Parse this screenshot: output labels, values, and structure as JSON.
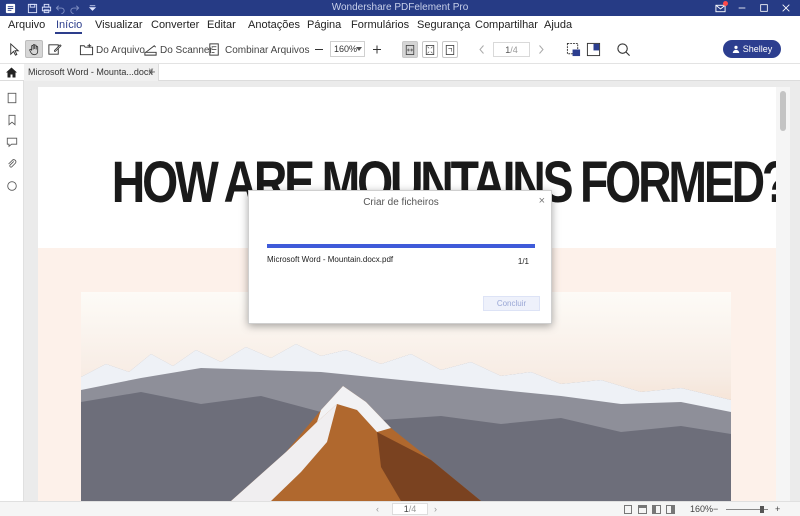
{
  "app": {
    "title": "Wondershare PDFelement Pro"
  },
  "menu": {
    "items": [
      "Arquivo",
      "Início",
      "Visualizar",
      "Converter",
      "Editar",
      "Anotações",
      "Página",
      "Formulários",
      "Segurança",
      "Compartilhar",
      "Ajuda"
    ],
    "active": "Início"
  },
  "toolbar": {
    "from_file": "Do Arquivo",
    "from_scanner": "Do Scanner",
    "combine": "Combinar Arquivos",
    "zoom": "160%",
    "page_current": "1",
    "page_total": "/4",
    "user": "Shelley"
  },
  "tabs": {
    "doc_tab": "Microsoft Word - Mounta...docx"
  },
  "document": {
    "headline": "HOW ARE MOUNTAINS FORMED?"
  },
  "modal": {
    "title": "Criar de ficheiros",
    "filename": "Microsoft Word - Mountain.docx.pdf",
    "count": "1/1",
    "progress": 1.0,
    "button": "Concluir"
  },
  "statusbar": {
    "page_current": "1",
    "page_total": "/4",
    "zoom": "160%"
  },
  "colors": {
    "titlebar": "#263b85",
    "accent": "#2c3e8f",
    "progress": "#3f5bd9"
  }
}
